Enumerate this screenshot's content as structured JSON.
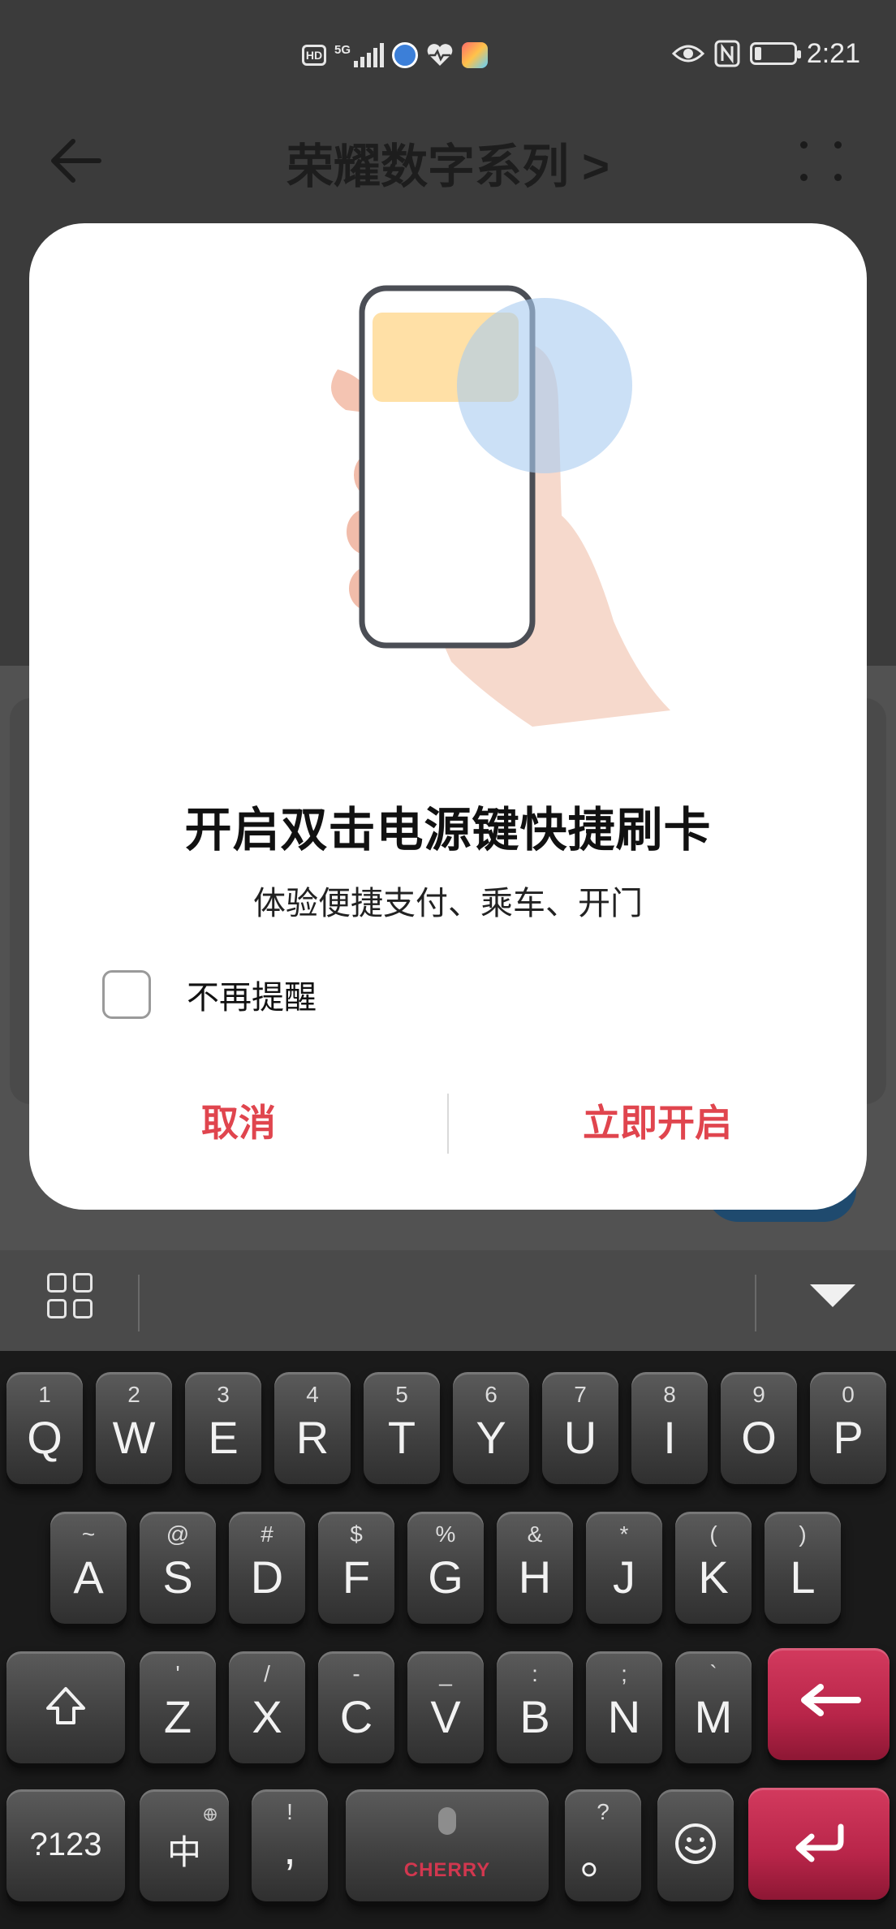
{
  "status_bar": {
    "network": "5G",
    "hd": "HD",
    "time": "2:21"
  },
  "header": {
    "title": "荣耀数字系列 >"
  },
  "dialog": {
    "title": "开启双击电源键快捷刷卡",
    "subtitle": "体验便捷支付、乘车、开门",
    "checkbox_label": "不再提醒",
    "checkbox_checked": false,
    "cancel_label": "取消",
    "confirm_label": "立即开启",
    "accent_color": "#e0454e"
  },
  "keyboard": {
    "row1": [
      {
        "sub": "1",
        "main": "Q"
      },
      {
        "sub": "2",
        "main": "W"
      },
      {
        "sub": "3",
        "main": "E"
      },
      {
        "sub": "4",
        "main": "R"
      },
      {
        "sub": "5",
        "main": "T"
      },
      {
        "sub": "6",
        "main": "Y"
      },
      {
        "sub": "7",
        "main": "U"
      },
      {
        "sub": "8",
        "main": "I"
      },
      {
        "sub": "9",
        "main": "O"
      },
      {
        "sub": "0",
        "main": "P"
      }
    ],
    "row2": [
      {
        "sub": "~",
        "main": "A"
      },
      {
        "sub": "@",
        "main": "S"
      },
      {
        "sub": "#",
        "main": "D"
      },
      {
        "sub": "$",
        "main": "F"
      },
      {
        "sub": "%",
        "main": "G"
      },
      {
        "sub": "&",
        "main": "H"
      },
      {
        "sub": "*",
        "main": "J"
      },
      {
        "sub": "(",
        "main": "K"
      },
      {
        "sub": ")",
        "main": "L"
      }
    ],
    "row3": [
      {
        "sub": "'",
        "main": "Z"
      },
      {
        "sub": "/",
        "main": "X"
      },
      {
        "sub": "-",
        "main": "C"
      },
      {
        "sub": "_",
        "main": "V"
      },
      {
        "sub": ":",
        "main": "B"
      },
      {
        "sub": ";",
        "main": "N"
      },
      {
        "sub": "`",
        "main": "M"
      }
    ],
    "symbols_key": "?123",
    "lang_key": "中",
    "comma_key": {
      "sub": "!",
      "main": ","
    },
    "period_key": {
      "sub": "?",
      "main": "。"
    },
    "space_brand": "CHERRY"
  }
}
